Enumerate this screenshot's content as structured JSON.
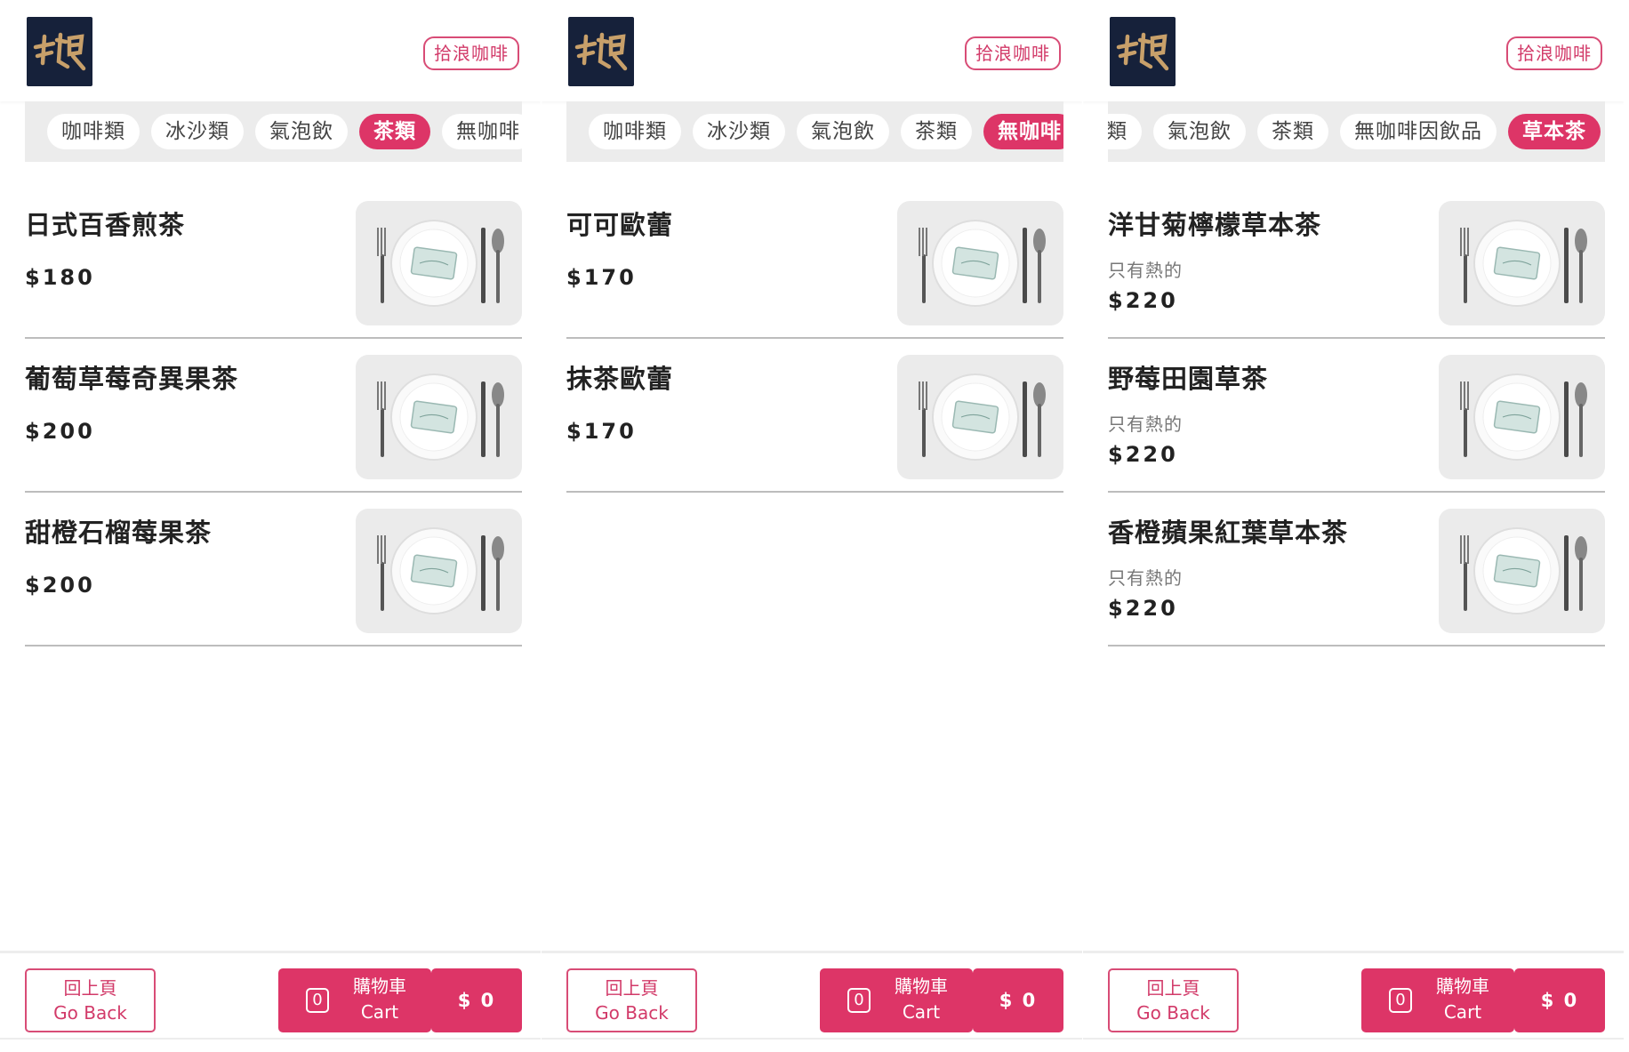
{
  "panels": [
    {
      "brand_label": "拾浪咖啡",
      "categories": [
        "咖啡類",
        "冰沙類",
        "氣泡飲",
        "茶類",
        "無咖啡"
      ],
      "active_category": "茶類",
      "items": [
        {
          "name": "日式百香煎茶",
          "note": "",
          "price": "$180"
        },
        {
          "name": "葡萄草莓奇異果茶",
          "note": "",
          "price": "$200"
        },
        {
          "name": "甜橙石榴莓果茶",
          "note": "",
          "price": "$200"
        }
      ],
      "footer": {
        "back_zh": "回上頁",
        "back_en": "Go Back",
        "cart_count": "0",
        "cart_zh": "購物車",
        "cart_en": "Cart",
        "total": "$ 0"
      }
    },
    {
      "brand_label": "拾浪咖啡",
      "categories": [
        "咖啡類",
        "冰沙類",
        "氣泡飲",
        "茶類",
        "無咖啡"
      ],
      "active_category": "無咖啡",
      "items": [
        {
          "name": "可可歐蕾",
          "note": "",
          "price": "$170"
        },
        {
          "name": "抹茶歐蕾",
          "note": "",
          "price": "$170"
        }
      ],
      "footer": {
        "back_zh": "回上頁",
        "back_en": "Go Back",
        "cart_count": "0",
        "cart_zh": "購物車",
        "cart_en": "Cart",
        "total": "$ 0"
      }
    },
    {
      "brand_label": "拾浪咖啡",
      "categories": [
        "類",
        "氣泡飲",
        "茶類",
        "無咖啡因飲品",
        "草本茶"
      ],
      "active_category": "草本茶",
      "items": [
        {
          "name": "洋甘菊檸檬草本茶",
          "note": "只有熱的",
          "price": "$220"
        },
        {
          "name": "野莓田園草茶",
          "note": "只有熱的",
          "price": "$220"
        },
        {
          "name": "香橙蘋果紅葉草本茶",
          "note": "只有熱的",
          "price": "$220"
        }
      ],
      "footer": {
        "back_zh": "回上頁",
        "back_en": "Go Back",
        "cart_count": "0",
        "cart_zh": "購物車",
        "cart_en": "Cart",
        "total": "$ 0"
      }
    }
  ],
  "colors": {
    "accent": "#dd3567",
    "logo_bg": "#16213a",
    "logo_gold": "#c8a06a",
    "tab_strip_bg": "#ececec",
    "divider": "#bdbdbd"
  },
  "icons": {
    "logo": "brand-calligraphy-logo",
    "item_image": "plate-fork-knife-placeholder"
  }
}
